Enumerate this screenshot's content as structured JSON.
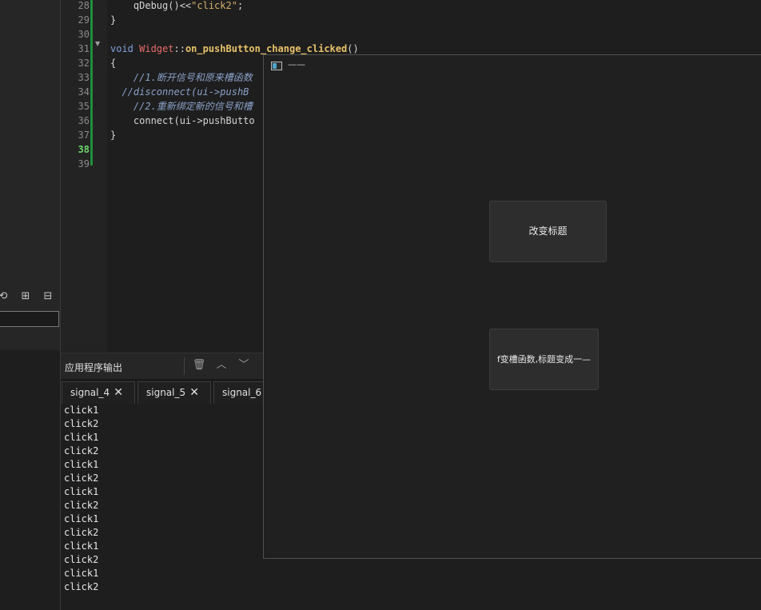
{
  "left_toolbar": {
    "icons": [
      "sync-icon",
      "add-folder-icon",
      "collapse-icon"
    ],
    "glyphs": [
      "⟲",
      "⊞",
      "⊟"
    ]
  },
  "editor": {
    "line_numbers": [
      "28",
      "29",
      "30",
      "31",
      "32",
      "33",
      "34",
      "35",
      "36",
      "37",
      "38",
      "39"
    ],
    "current_line": "38",
    "lines": [
      [
        "    qDebug()<<\"click2\";"
      ],
      [
        "}"
      ],
      [
        ""
      ],
      [
        "void Widget::on_pushButton_change_clicked()"
      ],
      [
        "{"
      ],
      [
        "    //1.断开信号和原来槽函数"
      ],
      [
        "  //disconnect(ui->pushB"
      ],
      [
        "    //2.重新绑定新的信号和槽"
      ],
      [
        "    connect(ui->pushButto"
      ],
      [
        "}"
      ],
      [
        ""
      ],
      [
        ""
      ]
    ]
  },
  "output_panel": {
    "title": "应用程序输出",
    "tabs": [
      "signal_4",
      "signal_5",
      "signal_6"
    ],
    "lines": [
      "click1",
      "click2",
      "click1",
      "click2",
      "click1",
      "click2",
      "click1",
      "click2",
      "click1",
      "click2",
      "click1",
      "click2",
      "click1",
      "click2"
    ]
  },
  "widget_window": {
    "title": "——",
    "button1_label": "改变标题",
    "button2_label": "f变槽函数,标题变成一—"
  },
  "colors": {
    "background": "#1e1e1e",
    "change_bar": "#1f8f3c",
    "current_line_number": "#6cd46c"
  }
}
